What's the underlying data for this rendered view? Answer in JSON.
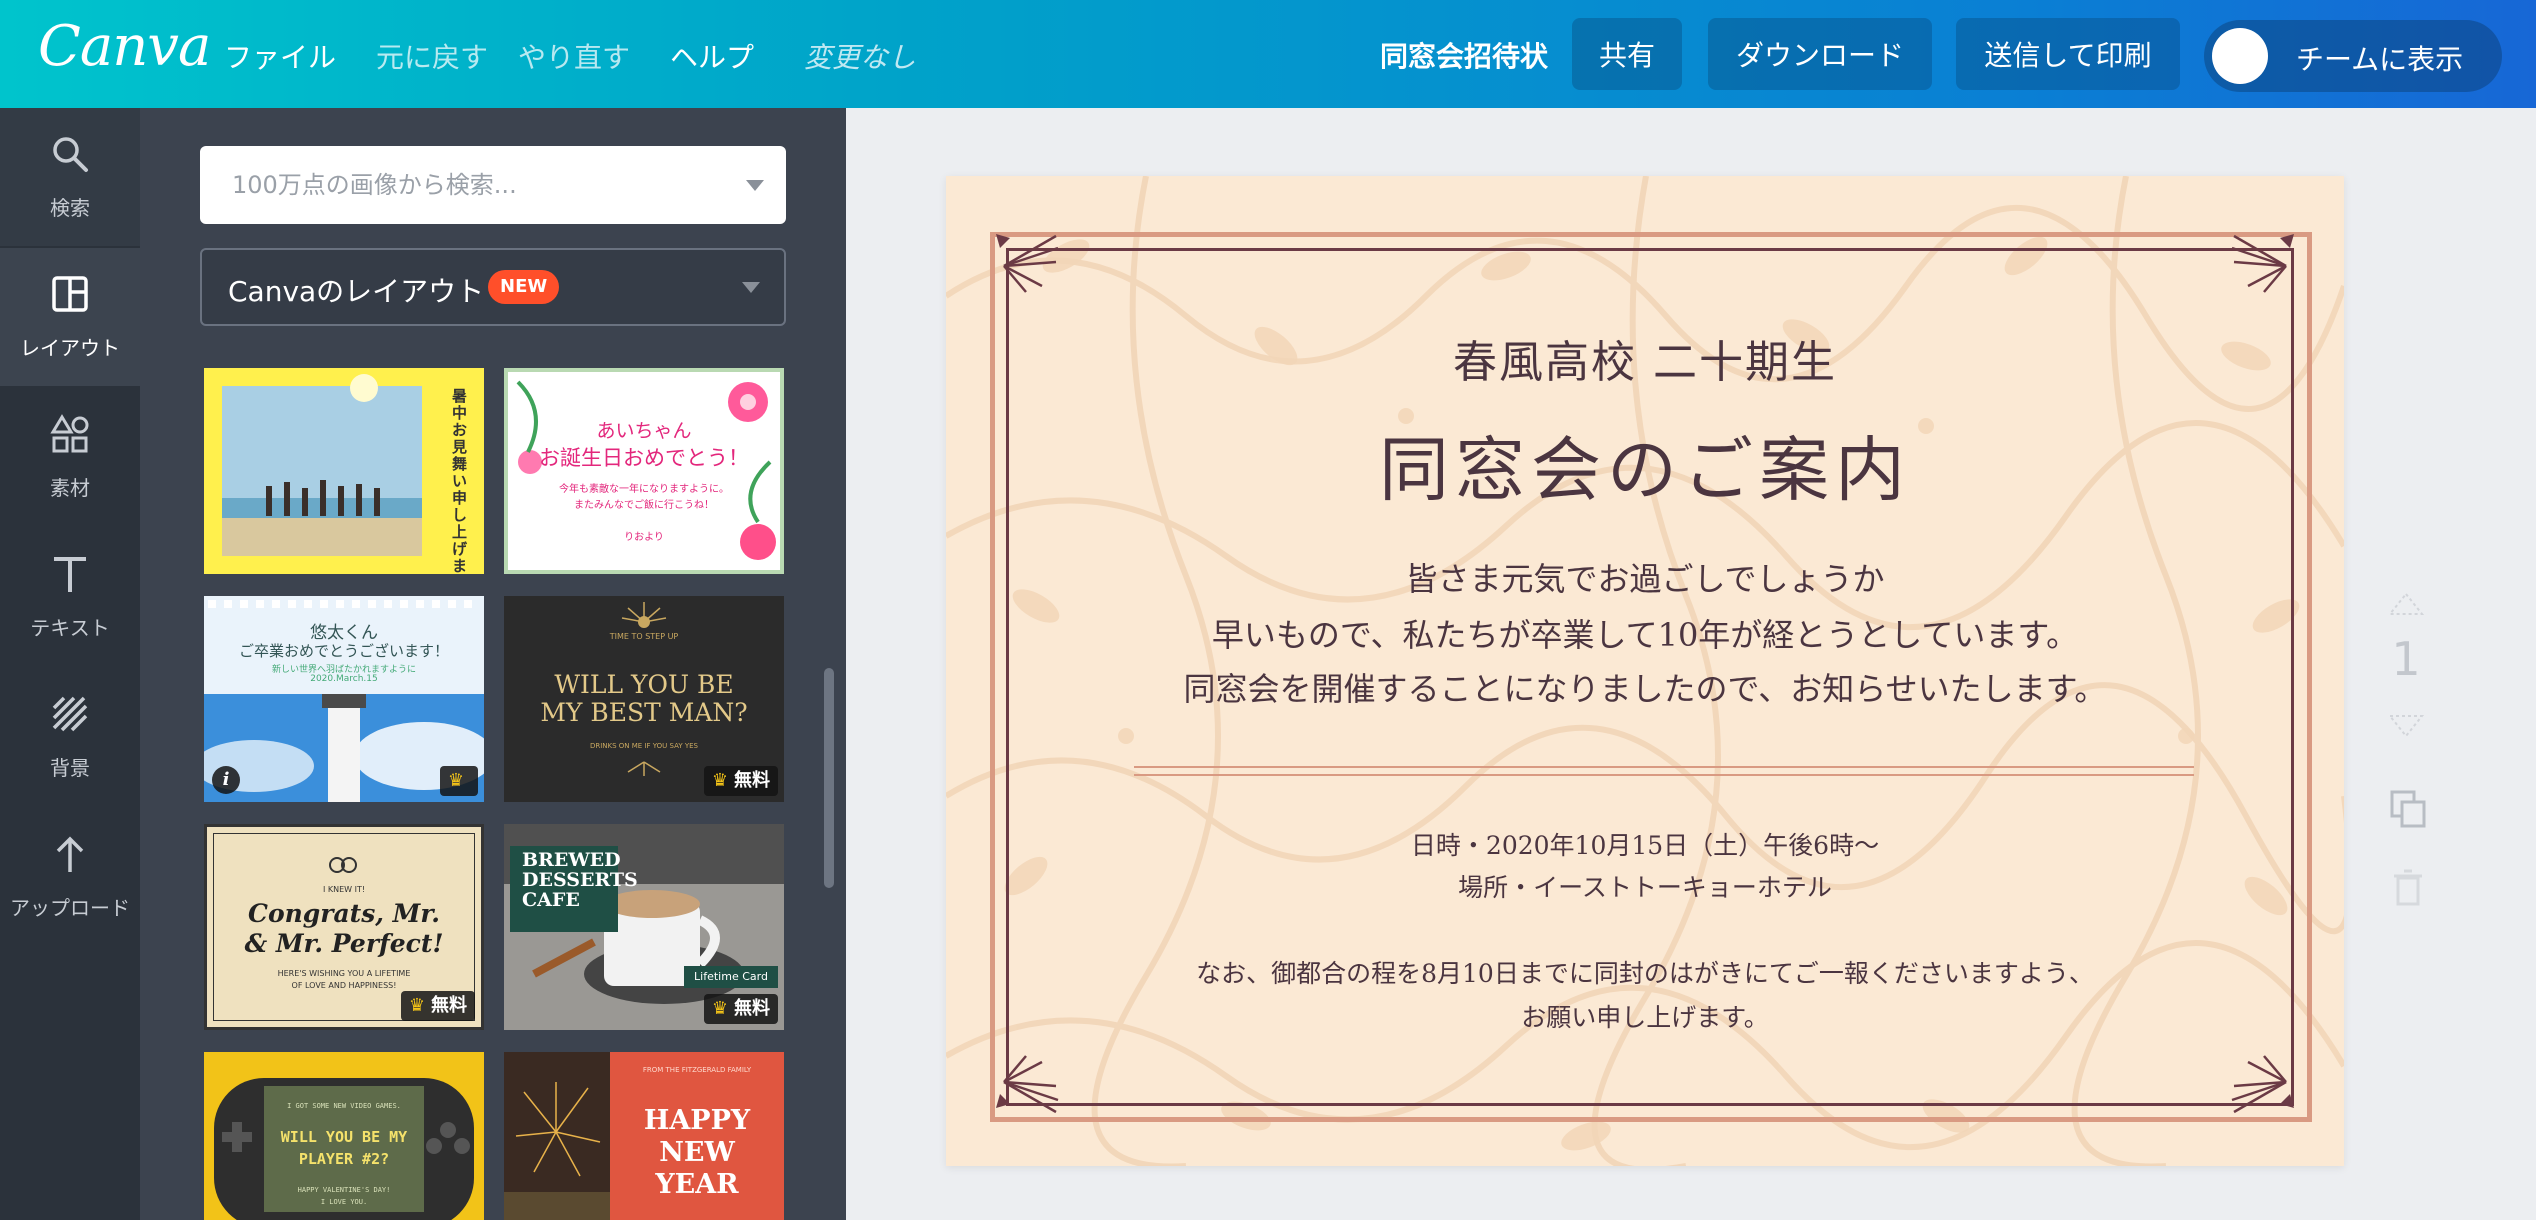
{
  "app": {
    "logo": "Canva",
    "menu": [
      "ファイル",
      "元に戻す",
      "やり直す",
      "ヘルプ"
    ],
    "status": "変更なし",
    "doc_title": "同窓会招待状",
    "buttons": {
      "share": "共有",
      "download": "ダウンロード",
      "print": "送信して印刷",
      "team": "チームに表示"
    }
  },
  "rail": [
    {
      "label": "検索",
      "icon": "search-icon"
    },
    {
      "label": "レイアウト",
      "icon": "layout-icon"
    },
    {
      "label": "素材",
      "icon": "elements-icon"
    },
    {
      "label": "テキスト",
      "icon": "text-icon"
    },
    {
      "label": "背景",
      "icon": "background-icon"
    },
    {
      "label": "アップロード",
      "icon": "upload-icon"
    }
  ],
  "panel": {
    "search_placeholder": "100万点の画像から検索...",
    "layout_select": "Canvaのレイアウト",
    "new_badge": "NEW",
    "thumbnails": [
      {
        "lines": [
          "暑中お見舞い申し上げます"
        ],
        "badge": ""
      },
      {
        "lines": [
          "あいちゃん",
          "お誕生日おめでとう！",
          "今年も素敵な一年になりますように。",
          "またみんなでご飯に行こうね！",
          "りおより"
        ],
        "badge": ""
      },
      {
        "lines": [
          "悠太くん",
          "ご卒業おめでとうございます！",
          "新しい世界へ羽ばたかれますように",
          "2020.March.15"
        ],
        "badge": ""
      },
      {
        "lines": [
          "TIME TO STEP UP",
          "WILL YOU BE",
          "MY BEST MAN?",
          "DRINKS ON ME IF YOU SAY YES"
        ],
        "badge": "無料"
      },
      {
        "lines": [
          "I KNEW IT!",
          "Congrats, Mr.",
          "& Mr. Perfect!",
          "HERE'S WISHING YOU A LIFETIME",
          "OF LOVE AND HAPPINESS!"
        ],
        "badge": "無料"
      },
      {
        "lines": [
          "BREWED",
          "DESSERTS",
          "CAFE",
          "Lifetime Card"
        ],
        "badge": "無料"
      },
      {
        "lines": [
          "I GOT SOME NEW VIDEO GAMES.",
          "WILL YOU BE MY",
          "PLAYER #2?",
          "HAPPY VALENTINE'S DAY!",
          "I LOVE YOU."
        ],
        "badge": ""
      },
      {
        "lines": [
          "FROM THE FITZGERALD FAMILY",
          "HAPPY",
          "NEW",
          "YEAR"
        ],
        "badge": ""
      }
    ]
  },
  "design": {
    "line1": "春風高校 二十期生",
    "title": "同窓会のご案内",
    "body": [
      "皆さま元気でお過ごしでしょうか",
      "早いもので、私たちが卒業して10年が経とうとしています。",
      "同窓会を開催することになりましたので、お知らせいたします。"
    ],
    "date": "日時・2020年10月15日（土）午後6時～",
    "place": "場所・イーストトーキョーホテル",
    "note": [
      "なお、御都合の程を8月10日までに同封のはがきにてご一報くださいますよう、",
      "お願い申し上げます。"
    ]
  },
  "page_number": "1",
  "colors": {
    "accent": "#00c4cc",
    "brand_blue": "#1767d6",
    "frame": "#d99a82",
    "frame_dark": "#6b3a45",
    "paper": "#fbe9d4",
    "new_badge": "#ff4f2a"
  }
}
